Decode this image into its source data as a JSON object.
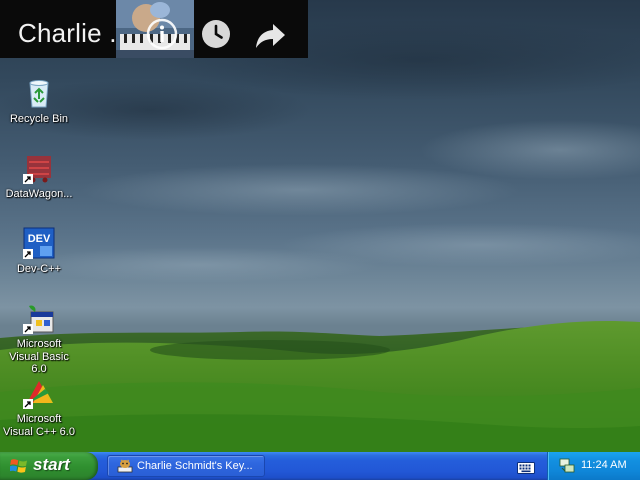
{
  "video_overlay": {
    "title": "Charlie ...",
    "icons": [
      "info-icon",
      "watch-later-clock-icon",
      "share-arrow-icon"
    ]
  },
  "desktop": {
    "icons": [
      {
        "label": "Recycle Bin",
        "icon": "recycle-bin-icon"
      },
      {
        "label": "DataWagon...",
        "icon": "datawagon-icon"
      },
      {
        "label": "Dev-C++",
        "icon": "dev-cpp-icon",
        "badge_text": "DEV"
      },
      {
        "label": "Microsoft Visual Basic 6.0",
        "icon": "visual-basic-icon"
      },
      {
        "label": "Microsoft Visual C++ 6.0",
        "icon": "visual-cpp-icon"
      }
    ]
  },
  "taskbar": {
    "start_label": "start",
    "task_button_label": "Charlie Schmidt's Key...",
    "tray_time": "11:24 AM"
  },
  "colors": {
    "taskbar_blue": "#245edb",
    "start_green": "#2f8f2f",
    "tray_blue": "#0f86d8",
    "overlay_black": "#0a0a0a"
  }
}
